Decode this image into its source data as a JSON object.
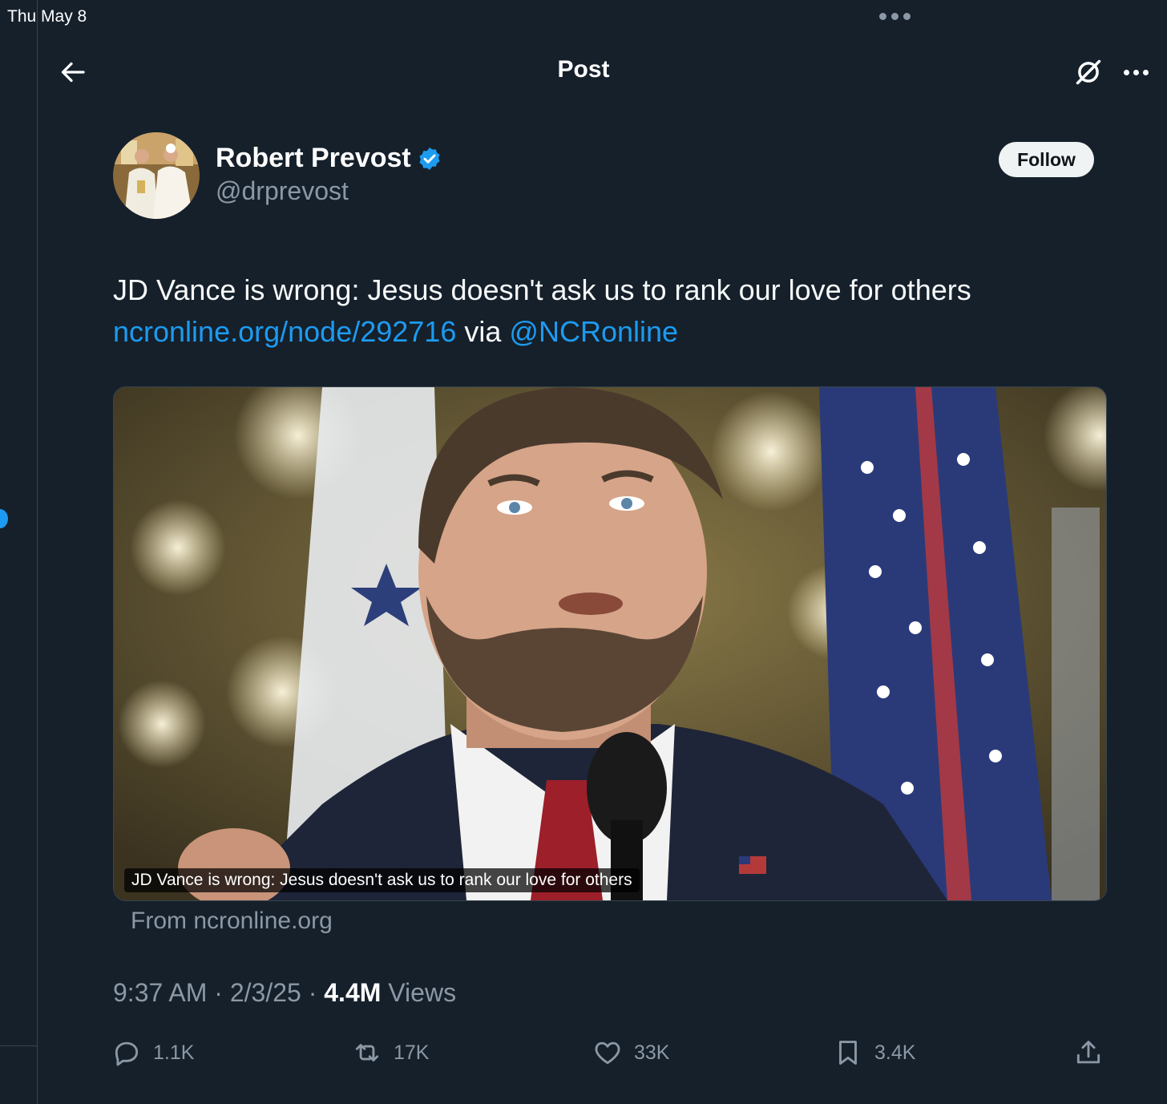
{
  "status_bar": {
    "time": "Thu May 8"
  },
  "header": {
    "title": "Post"
  },
  "author": {
    "display_name": "Robert Prevost",
    "handle": "@drprevost",
    "verified": true,
    "follow_label": "Follow"
  },
  "tweet": {
    "text": "JD Vance is wrong: Jesus doesn't ask us to rank our love for others",
    "link_text": "ncronline.org/node/292716",
    "via_text": "via",
    "mention": "@NCRonline"
  },
  "card": {
    "caption": "JD Vance is wrong: Jesus doesn't ask us to rank our love for others",
    "source": "From ncronline.org"
  },
  "meta": {
    "time": "9:37 AM",
    "separator": "·",
    "date": "2/3/25",
    "views_count": "4.4M",
    "views_label": "Views"
  },
  "actions": {
    "replies": "1.1K",
    "reposts": "17K",
    "likes": "33K",
    "bookmarks": "3.4K"
  },
  "colors": {
    "background": "#15202b",
    "accent": "#1d9bf0",
    "secondary_text": "#8b98a5",
    "border": "#38444d"
  }
}
